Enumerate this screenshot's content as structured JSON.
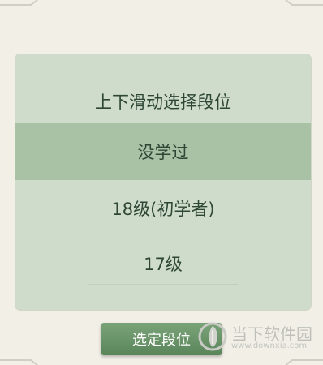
{
  "picker": {
    "title": "上下滑动选择段位",
    "options": [
      "没学过",
      "18级(初学者)",
      "17级"
    ],
    "selected_index": 0
  },
  "confirm_button": {
    "label": "选定段位"
  },
  "watermark": {
    "name": "当下软件园",
    "url": "www.downxia.com",
    "logo_icon": "downxia-logo-icon"
  },
  "colors": {
    "background": "#f1efe6",
    "panel": "#cfdccb",
    "selected_row": "#a9c1a5",
    "text": "#2e4634",
    "button": "#6a956a"
  }
}
